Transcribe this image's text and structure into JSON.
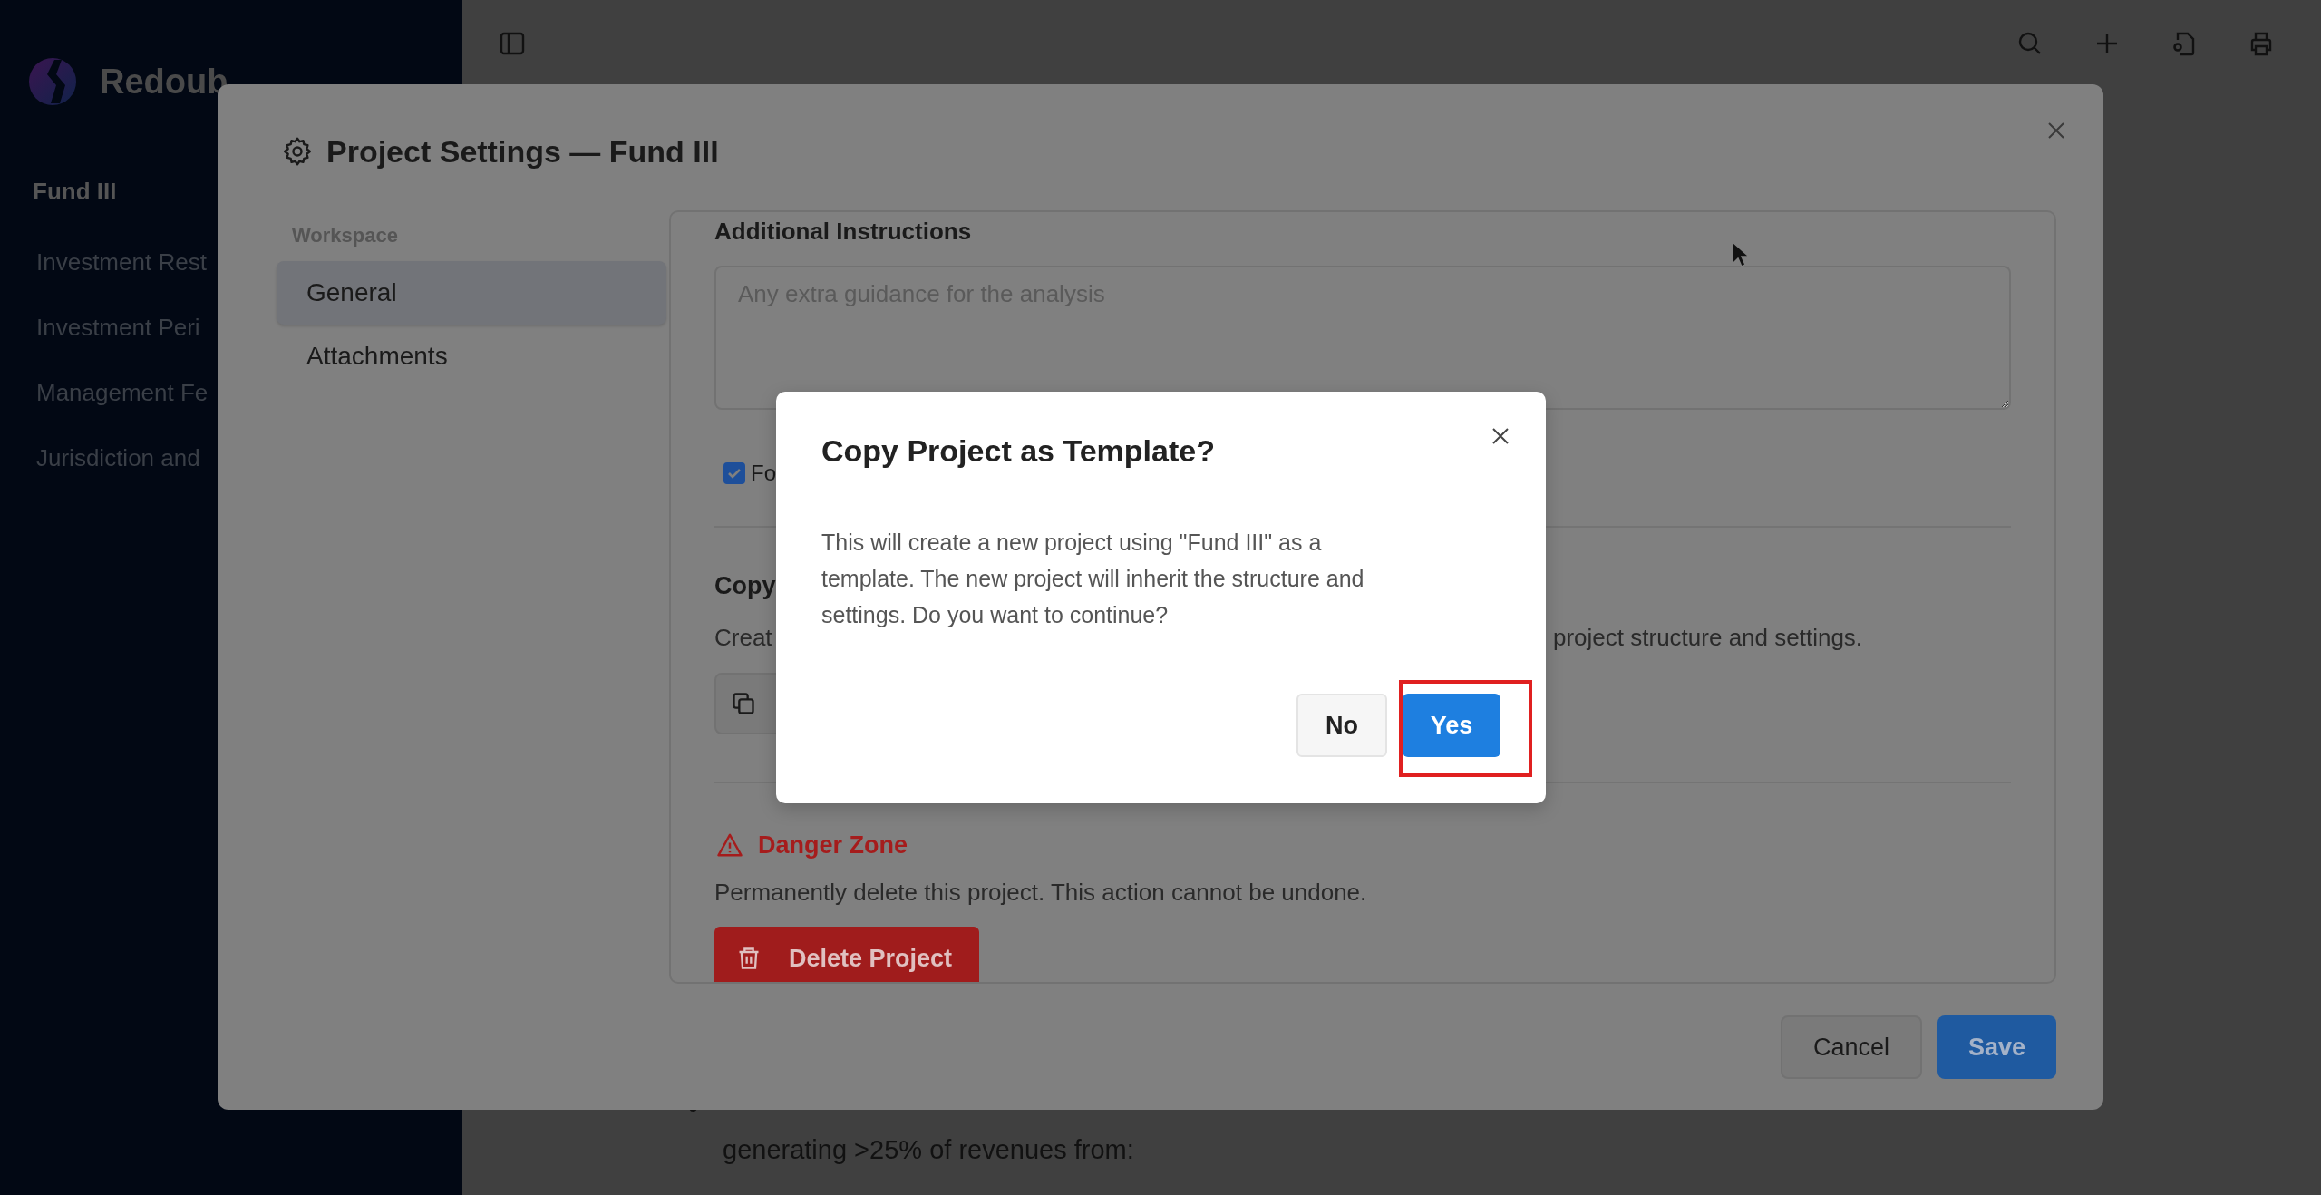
{
  "sidebar": {
    "brand": "Redoub",
    "project": "Fund III",
    "items": [
      {
        "label": "Investment Rest"
      },
      {
        "label": "Investment Peri"
      },
      {
        "label": "Management Fe"
      },
      {
        "label": "Jurisdiction and"
      }
    ]
  },
  "document": {
    "bullets": [
      {
        "text": "generating >25% of revenues from:"
      }
    ]
  },
  "settings_modal": {
    "title": "Project Settings — Fund III",
    "nav_group": "Workspace",
    "nav": [
      {
        "label": "General",
        "selected": true
      },
      {
        "label": "Attachments",
        "selected": false
      }
    ],
    "instructions": {
      "label": "Additional Instructions",
      "placeholder": "Any extra guidance for the analysis"
    },
    "checkbox": {
      "label": "Fo",
      "checked": true
    },
    "copy_section": {
      "heading": "Copy",
      "description_start": "Creat",
      "description_end": "project structure and settings."
    },
    "danger": {
      "heading": "Danger Zone",
      "description": "Permanently delete this project. This action cannot be undone.",
      "button": "Delete Project"
    },
    "buttons": [
      {
        "label": "Cancel",
        "kind": "secondary"
      },
      {
        "label": "Save",
        "kind": "primary"
      }
    ]
  },
  "confirm_dialog": {
    "title": "Copy Project as Template?",
    "message": "This will create a new project using \"Fund III\" as a template. The new project will inherit the structure and settings. Do you want to continue?",
    "buttons": [
      {
        "label": "No",
        "kind": "secondary",
        "highlighted": false
      },
      {
        "label": "Yes",
        "kind": "primary",
        "highlighted": true
      }
    ]
  }
}
